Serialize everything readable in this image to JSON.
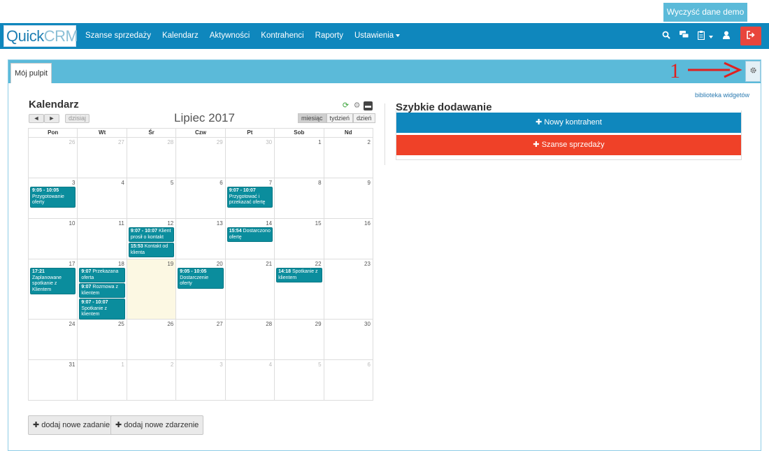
{
  "top": {
    "demo_button": "Wyczyść dane demo"
  },
  "navbar": {
    "logo_part1": "Quick",
    "logo_part2": "CRM",
    "items": [
      "Szanse sprzedaży",
      "Kalendarz",
      "Aktywności",
      "Kontrahenci",
      "Raporty",
      "Ustawienia"
    ],
    "icons": [
      "search-icon",
      "chat-icon",
      "clipboard-icon",
      "user-icon",
      "logout-icon"
    ],
    "colors": {
      "navbar": "#0f87bd",
      "logout": "#e8453c"
    }
  },
  "dashboard": {
    "tab_label": "Mój pulpit",
    "widget_library_link": "biblioteka widgetów",
    "annotation_number": "1"
  },
  "calendar": {
    "title": "Kalendarz",
    "today_button": "dzisiaj",
    "prev_glyph": "◄",
    "next_glyph": "►",
    "month_label": "Lipiec 2017",
    "views": [
      "miesiąc",
      "tydzień",
      "dzień"
    ],
    "active_view": "miesiąc",
    "weekdays": [
      "Pon",
      "Wt",
      "Śr",
      "Czw",
      "Pt",
      "Sob",
      "Nd"
    ],
    "weeks": [
      [
        {
          "d": "26",
          "o": true
        },
        {
          "d": "27",
          "o": true
        },
        {
          "d": "28",
          "o": true
        },
        {
          "d": "29",
          "o": true
        },
        {
          "d": "30",
          "o": true
        },
        {
          "d": "1"
        },
        {
          "d": "2"
        }
      ],
      [
        {
          "d": "3",
          "ev": [
            {
              "t": "9:05 - 10:05",
              "x": "Przygotowanie oferty"
            }
          ]
        },
        {
          "d": "4"
        },
        {
          "d": "5"
        },
        {
          "d": "6"
        },
        {
          "d": "7",
          "ev": [
            {
              "t": "9:07 - 10:07",
              "x": "Przygotować i przekazać ofertę"
            }
          ]
        },
        {
          "d": "8"
        },
        {
          "d": "9"
        }
      ],
      [
        {
          "d": "10"
        },
        {
          "d": "11"
        },
        {
          "d": "12",
          "ev": [
            {
              "t": "9:07 - 10:07",
              "x": "Klient prosił o kontakt"
            },
            {
              "t": "15:53",
              "x": "Kontakt od klienta"
            }
          ]
        },
        {
          "d": "13"
        },
        {
          "d": "14",
          "ev": [
            {
              "t": "15:54",
              "x": "Dostarczono ofertę"
            }
          ]
        },
        {
          "d": "15"
        },
        {
          "d": "16"
        }
      ],
      [
        {
          "d": "17",
          "ev": [
            {
              "t": "17:21",
              "x": "Zaplanowane spotkanie z Klientem"
            }
          ]
        },
        {
          "d": "18",
          "ev": [
            {
              "t": "9:07",
              "x": "Przekazana oferta"
            },
            {
              "t": "9:07",
              "x": "Rozmowa z klientem"
            },
            {
              "t": "9:07 - 10:07",
              "x": "Spotkanie z klientem"
            }
          ]
        },
        {
          "d": "19",
          "today": true
        },
        {
          "d": "20",
          "ev": [
            {
              "t": "9:05 - 10:05",
              "x": "Dostarczenie oferty"
            }
          ]
        },
        {
          "d": "21"
        },
        {
          "d": "22",
          "ev": [
            {
              "t": "14:18",
              "x": "Spotkanie z klientem"
            }
          ]
        },
        {
          "d": "23"
        }
      ],
      [
        {
          "d": "24"
        },
        {
          "d": "25"
        },
        {
          "d": "26"
        },
        {
          "d": "27"
        },
        {
          "d": "28"
        },
        {
          "d": "29"
        },
        {
          "d": "30"
        }
      ],
      [
        {
          "d": "31"
        },
        {
          "d": "1",
          "o": true
        },
        {
          "d": "2",
          "o": true
        },
        {
          "d": "3",
          "o": true
        },
        {
          "d": "4",
          "o": true
        },
        {
          "d": "5",
          "o": true
        },
        {
          "d": "6",
          "o": true
        }
      ]
    ],
    "add_task": "dodaj nowe zadanie",
    "add_event": "dodaj nowe zdarzenie",
    "event_color": "#0b8d9d"
  },
  "quick_add": {
    "title": "Szybkie dodawanie",
    "buttons": [
      "Nowy kontrahent",
      "Szanse sprzedaży"
    ]
  }
}
